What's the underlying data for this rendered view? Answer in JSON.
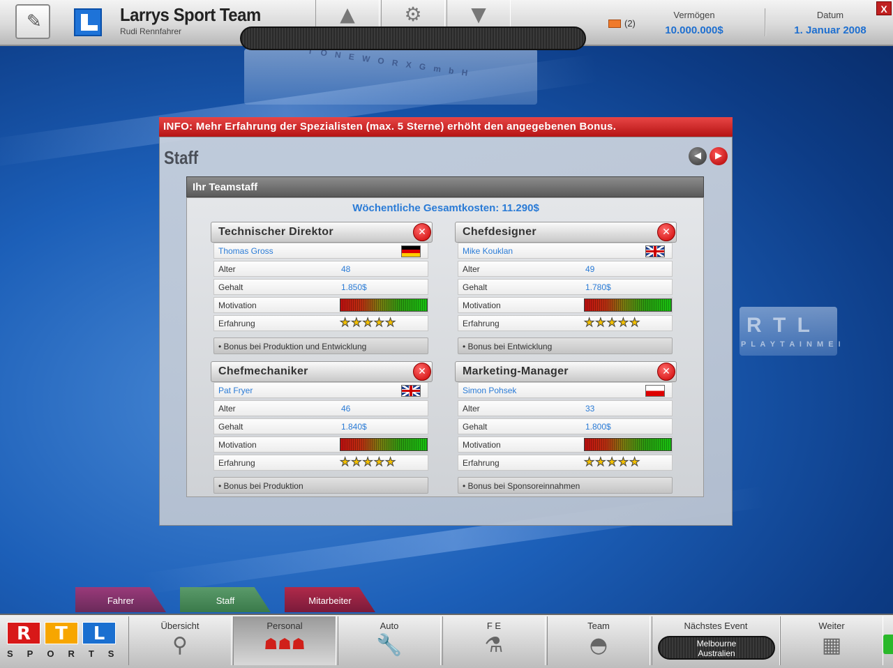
{
  "header": {
    "team_name": "Larrys Sport Team",
    "manager_name": "Rudi Rennfahrer",
    "mail_count": "(2)",
    "money_label": "Vermögen",
    "money_value": "10.000.000$",
    "date_label": "Datum",
    "date_value": "1. Januar 2008",
    "close_label": "X"
  },
  "background": {
    "logo1": "T O N E W O R X  G m b H",
    "logo2": "R T L",
    "logo3": "P L A Y T A I N M E I"
  },
  "info_text": "INFO: Mehr Erfahrung der Spezialisten (max. 5 Sterne) erhöht den angegebenen Bonus.",
  "dialog": {
    "title": "Staff",
    "section_title": "Ihr Teamstaff",
    "weekly_cost": "Wöchentliche Gesamtkosten: 11.290$"
  },
  "labels": {
    "age": "Alter",
    "salary": "Gehalt",
    "motivation": "Motivation",
    "experience": "Erfahrung"
  },
  "staff": [
    {
      "role": "Technischer Direktor",
      "name": "Thomas Gross",
      "flag": "de",
      "age": "48",
      "salary": "1.850$",
      "motivation": 1.0,
      "stars": "★★★★★",
      "bonus": "• Bonus bei Produktion und Entwicklung"
    },
    {
      "role": "Chefdesigner",
      "name": "Mike Kouklan",
      "flag": "uk",
      "age": "49",
      "salary": "1.780$",
      "motivation": 1.0,
      "stars": "★★★★★",
      "bonus": "• Bonus bei Entwicklung"
    },
    {
      "role": "Chefmechaniker",
      "name": "Pat Fryer",
      "flag": "uk",
      "age": "46",
      "salary": "1.840$",
      "motivation": 1.0,
      "stars": "★★★★★",
      "bonus": "• Bonus bei Produktion"
    },
    {
      "role": "Marketing-Manager",
      "name": "Simon Pohsek",
      "flag": "pl",
      "age": "33",
      "salary": "1.800$",
      "motivation": 1.0,
      "stars": "★★★★★",
      "bonus": "• Bonus bei Sponsoreinnahmen"
    }
  ],
  "subtabs": [
    "Fahrer",
    "Staff",
    "Mitarbeiter"
  ],
  "bottom_nav": {
    "rtl_r": "R",
    "rtl_t": "T",
    "rtl_l": "L",
    "rtl_sports": "SPORTS",
    "overview": "Übersicht",
    "personnel": "Personal",
    "car": "Auto",
    "rnd": "F E",
    "team": "Team",
    "next_event": "Nächstes Event",
    "event_city": "Melbourne",
    "event_country": "Australien",
    "next": "Weiter"
  },
  "icons": {
    "nav1": "▲",
    "nav2": "⚙",
    "nav3": "▼",
    "overview": "⚲",
    "personnel": "☗☗☗",
    "car": "🔧",
    "rnd": "⚗",
    "team": "◓",
    "next": "▦"
  },
  "colors": {
    "accent_blue": "#2a7bd6",
    "info_red": "#d02020",
    "star_gold": "#f4c000"
  }
}
